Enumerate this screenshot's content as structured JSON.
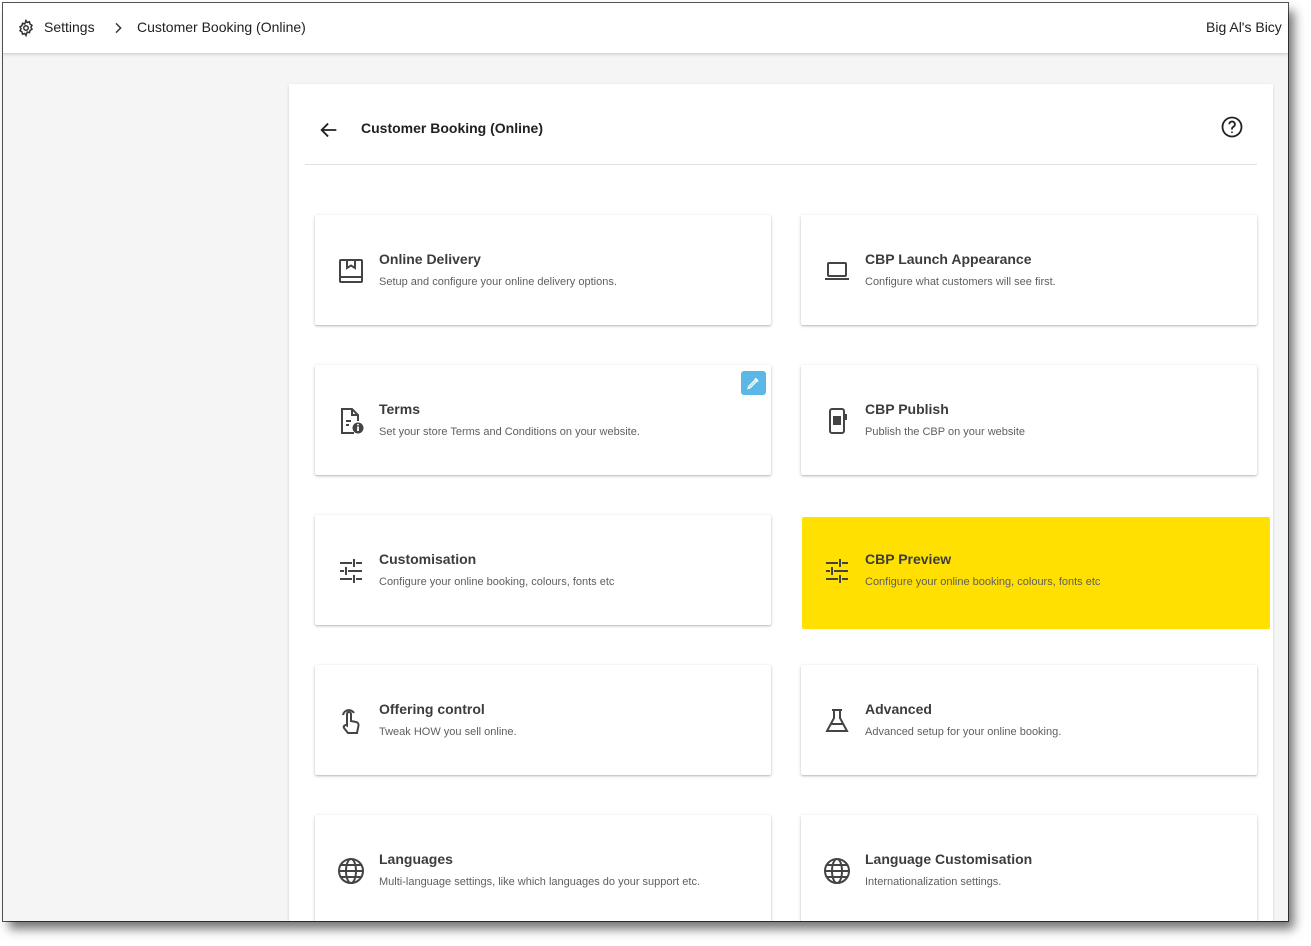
{
  "topbar": {
    "breadcrumb": [
      "Settings",
      "Customer Booking (Online)"
    ],
    "store_name": "Big Al's Bicy"
  },
  "panel": {
    "title": "Customer Booking (Online)"
  },
  "cards": [
    {
      "title": "Online Delivery",
      "desc": "Setup and configure your online delivery options.",
      "icon": "delivery-box-icon"
    },
    {
      "title": "CBP Launch Appearance",
      "desc": "Configure what customers will see first.",
      "icon": "laptop-icon"
    },
    {
      "title": "Terms",
      "desc": "Set your store Terms and Conditions on your website.",
      "icon": "document-info-icon",
      "badge": "edit-badge-icon"
    },
    {
      "title": "CBP Publish",
      "desc": "Publish the CBP on your website",
      "icon": "mobile-qr-icon"
    },
    {
      "title": "Customisation",
      "desc": "Configure your online booking, colours, fonts etc",
      "icon": "tune-icon"
    },
    {
      "title": "CBP Preview",
      "desc": "Configure your online booking, colours, fonts etc",
      "icon": "tune-icon",
      "highlight_color": "#ffe000"
    },
    {
      "title": "Offering control",
      "desc": "Tweak HOW you sell online.",
      "icon": "touch-icon"
    },
    {
      "title": "Advanced",
      "desc": "Advanced setup for your online booking.",
      "icon": "flask-icon"
    },
    {
      "title": "Languages",
      "desc": "Multi-language settings, like which languages do your support etc.",
      "icon": "globe-icon"
    },
    {
      "title": "Language Customisation",
      "desc": "Internationalization settings.",
      "icon": "globe-icon"
    }
  ],
  "colors": {
    "highlight": "#ffe000",
    "badge": "#5bb8e6",
    "text": "#212121"
  }
}
